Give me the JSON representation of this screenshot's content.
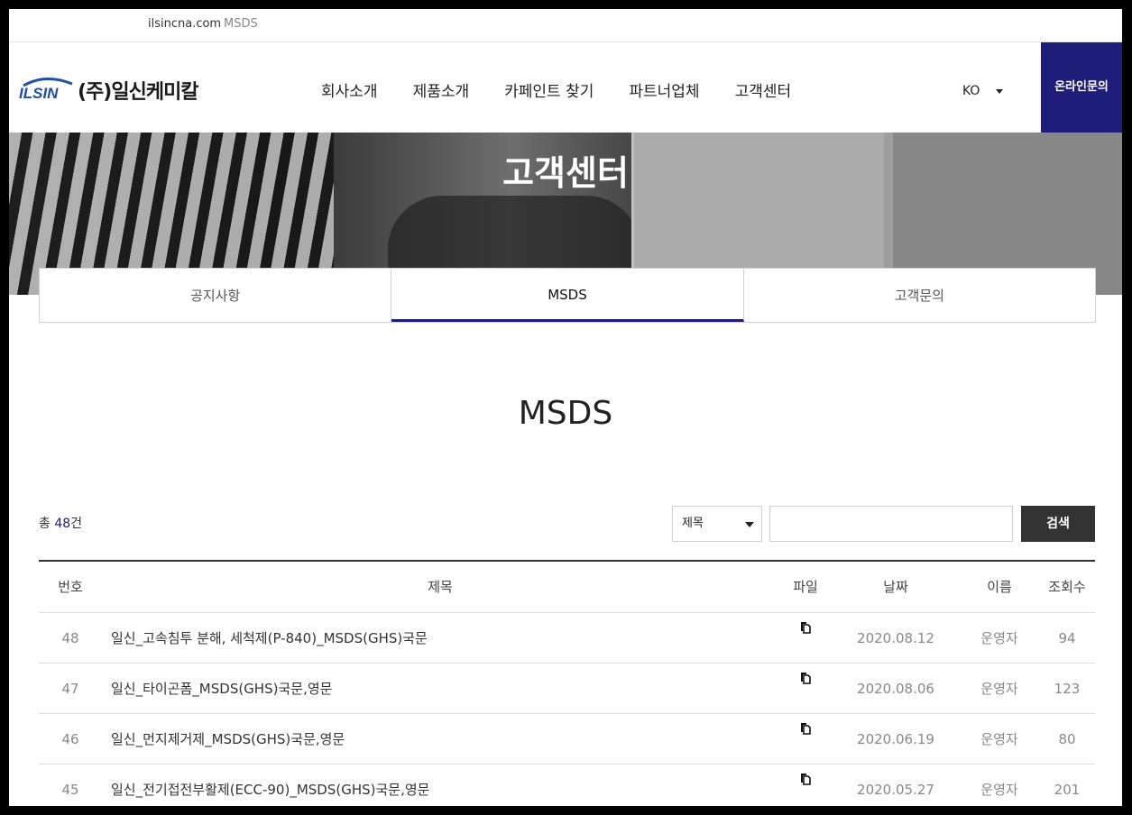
{
  "topbar": {
    "domain": "ilsincna.com",
    "section": "MSDS"
  },
  "header": {
    "logo_mark": "ILSIN",
    "logo_name": "(주)일신케미칼",
    "nav": [
      "회사소개",
      "제품소개",
      "카페인트 찾기",
      "파트너업체",
      "고객센터"
    ],
    "lang": "KO",
    "online_inquiry": "온라인문의"
  },
  "banner": {
    "title": "고객센터"
  },
  "tabs": [
    {
      "label": "공지사항",
      "active": false
    },
    {
      "label": "MSDS",
      "active": true
    },
    {
      "label": "고객문의",
      "active": false
    }
  ],
  "page_title": "MSDS",
  "search": {
    "total_prefix": "총",
    "total_count": "48",
    "total_suffix": "건",
    "field_option": "제목",
    "input_value": "",
    "button_label": "검색"
  },
  "table": {
    "headers": {
      "no": "번호",
      "title": "제목",
      "file": "파일",
      "date": "날짜",
      "name": "이름",
      "views": "조회수"
    },
    "rows": [
      {
        "no": "48",
        "title": "일신_고속침투 분해, 세척제(P-840)_MSDS(GHS)국문",
        "date": "2020.08.12",
        "name": "운영자",
        "views": "94"
      },
      {
        "no": "47",
        "title": "일신_타이곤폼_MSDS(GHS)국문,영문",
        "date": "2020.08.06",
        "name": "운영자",
        "views": "123"
      },
      {
        "no": "46",
        "title": "일신_먼지제거제_MSDS(GHS)국문,영문",
        "date": "2020.06.19",
        "name": "운영자",
        "views": "80"
      },
      {
        "no": "45",
        "title": "일신_전기접전부활제(ECC-90)_MSDS(GHS)국문,영문",
        "date": "2020.05.27",
        "name": "운영자",
        "views": "201"
      }
    ]
  },
  "colors": {
    "brand_navy": "#1e1e7a",
    "logo_blue": "#1f4fa8",
    "button_dark": "#333333"
  },
  "icons": {
    "file": "file-copy-icon",
    "dropdown": "chevron-down-icon"
  }
}
